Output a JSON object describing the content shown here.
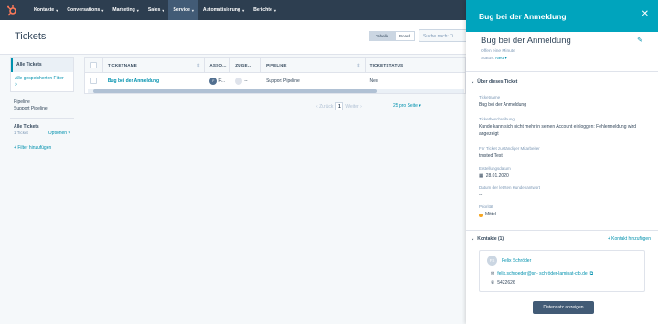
{
  "topnav": {
    "items": [
      {
        "label": "Kontakte"
      },
      {
        "label": "Conversations"
      },
      {
        "label": "Marketing"
      },
      {
        "label": "Sales"
      },
      {
        "label": "Service",
        "active": true
      },
      {
        "label": "Automatisierung"
      },
      {
        "label": "Berichte"
      }
    ]
  },
  "header": {
    "title": "Tickets",
    "view_table": "Tabelle",
    "view_board": "Board",
    "search_placeholder": "Suche nach: Ti"
  },
  "sidebar": {
    "all_tickets": "Alle Tickets",
    "saved_filters": "Alle gespeicherten Filter",
    "saved_filters_arrow": ">",
    "pipeline_label": "Pipeline",
    "pipeline_value": "Support Pipeline",
    "group_title": "Alle Tickets",
    "group_count": "1 Ticket",
    "options": "Optionen",
    "add_filter": "Filter hinzufügen"
  },
  "table": {
    "columns": [
      "TICKETNAME",
      "ASSO...",
      "ZUGE...",
      "PIPELINE",
      "TICKETSTATUS"
    ],
    "rows": [
      {
        "name": "Bug bei der Anmeldung",
        "assoc": "F...",
        "zuge": "--",
        "pipeline": "Support Pipeline",
        "status": "Neu"
      }
    ]
  },
  "pager": {
    "prev": "Zurück",
    "page": "1",
    "next": "Weiter",
    "per_page": "25 pro Seite"
  },
  "panel": {
    "title": "Bug bei der Anmeldung",
    "record_name": "Bug bei der Anmeldung",
    "subtitle": "Offen eine Minute",
    "status_label": "Status:",
    "status_value": "Neu",
    "about_section": "Über dieses Ticket",
    "fields": {
      "ticketname_label": "Ticketname",
      "ticketname_value": "Bug bei der Anmeldung",
      "desc_label": "Ticketbeschreibung",
      "desc_value": "Kunde kann sich nicht mehr in seinen Account einloggen: Fehlermeldung wird angezeigt",
      "owner_label": "Für Ticket zuständiger Mitarbeiter",
      "owner_value": "trusted Test",
      "created_label": "Erstellungsdatum",
      "created_value": "28.01.2020",
      "last_reply_label": "Datum der letzten Kundenantwort",
      "last_reply_value": "--",
      "priority_label": "Priorität",
      "priority_value": "Mittel"
    },
    "contacts_section": "Kontakte (1)",
    "add_contact": "+ Kontakt hinzufügen",
    "contact": {
      "initials": "FS",
      "name": "Felix Schröder",
      "email": "felix.schroeder@sn- schröder-laminat-ctb.de",
      "phone": "5422626"
    },
    "show_data_button": "Datensatz anzeigen"
  },
  "colors": {
    "nav_bg": "#2d3e50",
    "accent": "#00a4bd",
    "link": "#0091ae",
    "priority": "#f5a623"
  }
}
